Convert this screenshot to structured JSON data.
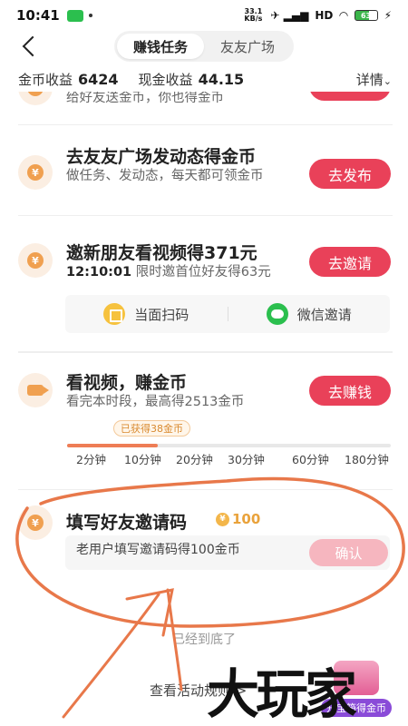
{
  "status_bar": {
    "time": "10:41",
    "speed": "33.1 KB/s",
    "signal": "HD",
    "battery": "63"
  },
  "nav": {
    "back_label": "返回",
    "tabs": [
      {
        "label": "赚钱任务",
        "active": true
      },
      {
        "label": "友友广场",
        "active": false
      }
    ]
  },
  "earnings": {
    "coin_label": "金币收益",
    "coin_value": "6424",
    "cash_label": "现金收益",
    "cash_value": "44.15",
    "detail_label": "详情"
  },
  "tasks": [
    {
      "subtitle": "给好友送金币，你也得金币"
    },
    {
      "title": "去友友广场发动态得金币",
      "subtitle": "做任务、发动态，每天都可领金币",
      "button": "去发布"
    },
    {
      "title": "邀新朋友看视频得371元",
      "timer": "12:10:01",
      "subtitle_rest": "限时邀首位好友得63元",
      "button": "去邀请",
      "share": {
        "scan_label": "当面扫码",
        "wechat_label": "微信邀请"
      }
    },
    {
      "title": "看视频，赚金币",
      "subtitle": "看完本时段，最高得2513金币",
      "button": "去赚钱",
      "earned_badge": "已获得38金币",
      "progress_fraction": 0.28,
      "ticks": [
        "2分钟",
        "10分钟",
        "20分钟",
        "30分钟",
        "60分钟",
        "180分钟"
      ]
    },
    {
      "title": "填写好友邀请码",
      "reward": "100",
      "input_placeholder": "老用户填写邀请码得100金币",
      "button": "确认"
    }
  ],
  "footer": {
    "end_note": "已经到底了",
    "rules_link": "查看活动规则 >"
  },
  "overlay": {
    "chest_label": "开宝箱得金币",
    "watermark": "大玩家"
  },
  "colors": {
    "accent": "#e94159",
    "coin": "#f0a050",
    "annotation": "#e8784a"
  },
  "icons": {
    "coin": "yen-coin-icon",
    "video": "video-camera-icon",
    "qr": "qr-code-icon",
    "wechat": "wechat-icon"
  }
}
